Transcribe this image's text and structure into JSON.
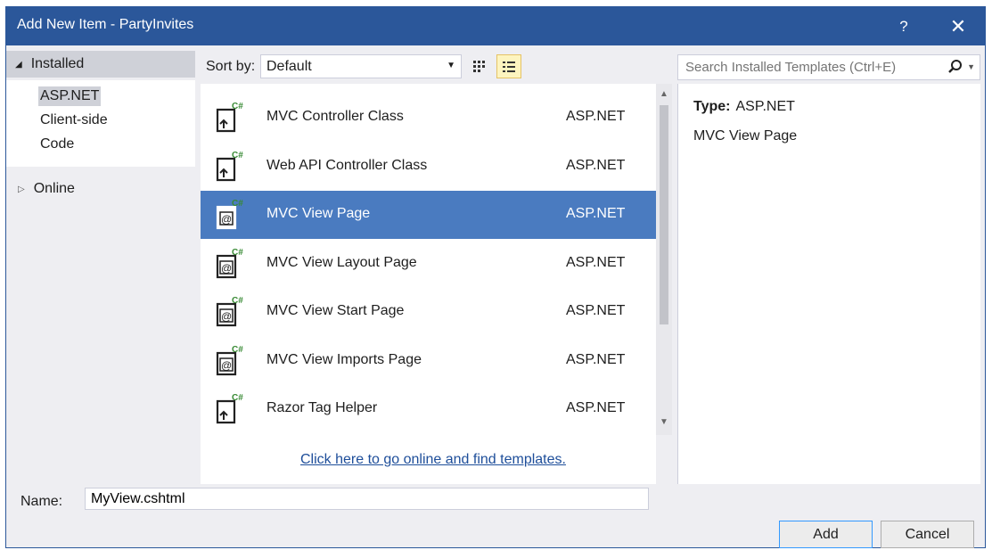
{
  "window": {
    "title": "Add New Item - PartyInvites",
    "help_label": "?",
    "close_label": "✕"
  },
  "sidebar": {
    "installed_label": "Installed",
    "items": [
      {
        "label": "ASP.NET",
        "selected": true
      },
      {
        "label": "Client-side",
        "selected": false
      },
      {
        "label": "Code",
        "selected": false
      }
    ],
    "online_label": "Online"
  },
  "toolbar": {
    "sort_label": "Sort by:",
    "sort_value": "Default"
  },
  "search": {
    "placeholder": "Search Installed Templates (Ctrl+E)"
  },
  "templates": [
    {
      "name": "MVC Controller Class",
      "category": "ASP.NET",
      "icon": "controller-icon",
      "selected": false
    },
    {
      "name": "Web API Controller Class",
      "category": "ASP.NET",
      "icon": "controller-icon",
      "selected": false
    },
    {
      "name": "MVC View Page",
      "category": "ASP.NET",
      "icon": "razor-page-icon",
      "selected": true
    },
    {
      "name": "MVC View Layout Page",
      "category": "ASP.NET",
      "icon": "razor-page-icon",
      "selected": false
    },
    {
      "name": "MVC View Start Page",
      "category": "ASP.NET",
      "icon": "razor-page-icon",
      "selected": false
    },
    {
      "name": "MVC View Imports Page",
      "category": "ASP.NET",
      "icon": "razor-page-icon",
      "selected": false
    },
    {
      "name": "Razor Tag Helper",
      "category": "ASP.NET",
      "icon": "controller-icon",
      "selected": false
    }
  ],
  "online_link": "Click here to go online and find templates.",
  "details": {
    "type_label": "Type:",
    "type_value": "ASP.NET",
    "description": "MVC View Page"
  },
  "name_field": {
    "label": "Name:",
    "value": "MyView.cshtml"
  },
  "buttons": {
    "add": "Add",
    "cancel": "Cancel"
  },
  "colors": {
    "titlebar": "#2b579a",
    "selection": "#4a7bc0",
    "csharp_badge": "#388a34"
  }
}
